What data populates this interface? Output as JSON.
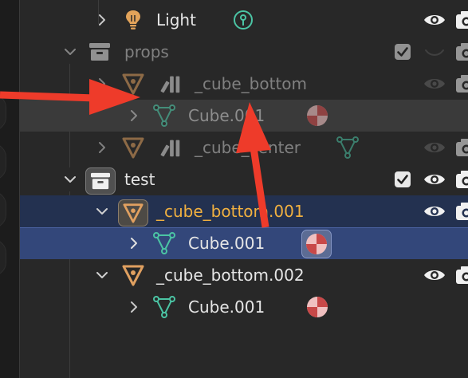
{
  "rows": [
    {
      "label": "Light"
    },
    {
      "label": "props"
    },
    {
      "label": "_cube_bottom"
    },
    {
      "label": "Cube.001"
    },
    {
      "label": "_cube_center"
    },
    {
      "label": "test"
    },
    {
      "label": "_cube_bottom.001"
    },
    {
      "label": "Cube.001"
    },
    {
      "label": "_cube_bottom.002"
    },
    {
      "label": "Cube.001"
    }
  ],
  "colors": {
    "background": "#282828",
    "active_row": "#33477a",
    "parent_row": "#233150",
    "active_name": "#f0b040",
    "mesh_icon": "#4bc4a4",
    "object_icon": "#e0a060",
    "material_icon": "#d05050",
    "annotation_arrow": "#ee3b2a"
  },
  "icons": [
    "chevron-right-icon",
    "chevron-down-icon",
    "light-object-icon",
    "light-data-icon",
    "collection-icon",
    "object-icon",
    "linked-library-icon",
    "mesh-data-icon",
    "material-icon",
    "checkbox-checked-icon",
    "eye-icon",
    "camera-icon"
  ]
}
